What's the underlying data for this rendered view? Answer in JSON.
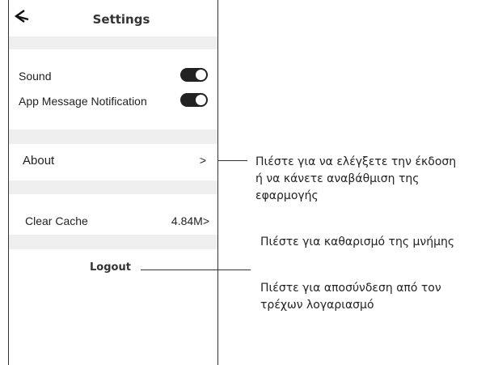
{
  "header": {
    "title": "Settings",
    "back_icon": "back-arrow-icon"
  },
  "settings": {
    "sound_label": "Sound",
    "notification_label": "App Message Notification",
    "about_label": "About",
    "about_chevron": ">",
    "clear_cache_label": "Clear Cache",
    "clear_cache_value": "4.84M>",
    "logout_label": "Logout"
  },
  "toggles": {
    "sound_on": true,
    "notification_on": true
  },
  "annotations": {
    "about_line1": "Πιέστε για να ελέγξετε την έκδοση",
    "about_line2": "ή να κάνετε αναβάθμιση της",
    "about_line3": "εφαρμογής",
    "clear_cache": "Πιέστε για καθαρισμό της μνήμης",
    "logout_line1": "Πιέστε για αποσύνδεση από τον",
    "logout_line2": "τρέχων λογαριασμό"
  },
  "colors": {
    "toggle_on": "#222222",
    "separator": "#efefef"
  }
}
